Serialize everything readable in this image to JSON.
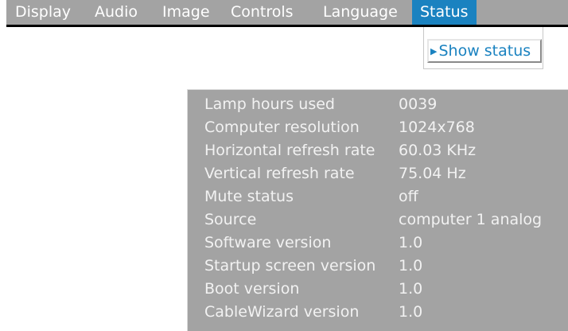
{
  "menubar": {
    "items": [
      {
        "label": "Display"
      },
      {
        "label": "Audio"
      },
      {
        "label": "Image"
      },
      {
        "label": "Controls"
      },
      {
        "label": "Language"
      },
      {
        "label": "Status"
      }
    ],
    "active": "Status"
  },
  "submenu": {
    "arrow": "▶",
    "items": [
      {
        "label": "Show status"
      }
    ]
  },
  "status_panel": {
    "rows": [
      {
        "label": "Lamp hours used",
        "value": "0039"
      },
      {
        "label": "Computer resolution",
        "value": "1024x768"
      },
      {
        "label": "Horizontal refresh rate",
        "value": "60.03 KHz"
      },
      {
        "label": "Vertical refresh rate",
        "value": "75.04 Hz"
      },
      {
        "label": "Mute status",
        "value": "off"
      },
      {
        "label": "Source",
        "value": "computer 1 analog"
      },
      {
        "label": "Software version",
        "value": "1.0"
      },
      {
        "label": "Startup screen version",
        "value": "1.0"
      },
      {
        "label": "Boot version",
        "value": "1.0"
      },
      {
        "label": "CableWizard version",
        "value": "1.0"
      }
    ]
  },
  "colors": {
    "menubar_bg": "#a3a3a3",
    "accent": "#1a82c0",
    "panel_bg": "#a3a3a3",
    "text_light": "#ffffff"
  }
}
